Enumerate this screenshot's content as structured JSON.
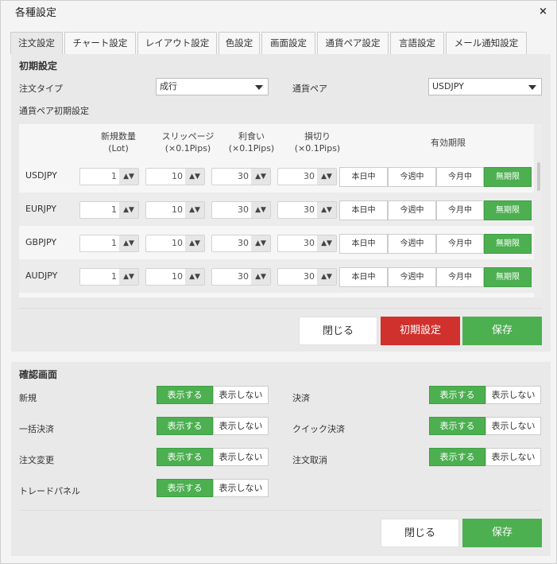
{
  "window": {
    "title": "各種設定",
    "close": "×"
  },
  "tabs": [
    {
      "label": "注文設定",
      "active": true
    },
    {
      "label": "チャート設定"
    },
    {
      "label": "レイアウト設定"
    },
    {
      "label": "色設定"
    },
    {
      "label": "画面設定"
    },
    {
      "label": "通貨ペア設定"
    },
    {
      "label": "言語設定"
    },
    {
      "label": "メール通知設定"
    }
  ],
  "initial": {
    "title": "初期設定",
    "order_type_label": "注文タイプ",
    "order_type_value": "成行",
    "pair_label": "通貨ペア",
    "pair_value": "USDJPY",
    "pair_defaults_label": "通貨ペア初期設定"
  },
  "grid": {
    "headers": {
      "qty": [
        "新規数量",
        "(Lot)"
      ],
      "slip": [
        "スリッページ",
        "(×0.1Pips)"
      ],
      "tp": [
        "利食い",
        "(×0.1Pips)"
      ],
      "sl": [
        "損切り",
        "(×0.1Pips)"
      ],
      "expiry": "有効期限"
    },
    "arrows": "▲▼",
    "expiry_options": [
      "本日中",
      "今週中",
      "今月中",
      "無期限"
    ],
    "expiry_selected": "無期限",
    "rows": [
      {
        "pair": "USDJPY",
        "qty": "1",
        "slip": "10",
        "tp": "30",
        "sl": "30"
      },
      {
        "pair": "EURJPY",
        "qty": "1",
        "slip": "10",
        "tp": "30",
        "sl": "30"
      },
      {
        "pair": "GBPJPY",
        "qty": "1",
        "slip": "10",
        "tp": "30",
        "sl": "30"
      },
      {
        "pair": "AUDJPY",
        "qty": "1",
        "slip": "10",
        "tp": "30",
        "sl": "30"
      }
    ]
  },
  "buttons": {
    "close": "閉じる",
    "reset": "初期設定",
    "save": "保存"
  },
  "confirm": {
    "title": "確認画面",
    "show": "表示する",
    "hide": "表示しない",
    "items": {
      "new": "新規",
      "settle": "決済",
      "bulk": "一括決済",
      "quick": "クイック決済",
      "modify": "注文変更",
      "cancel": "注文取消",
      "panel": "トレードパネル"
    }
  },
  "colors": {
    "accent_green": "#4caf50",
    "danger_red": "#d0312d"
  }
}
